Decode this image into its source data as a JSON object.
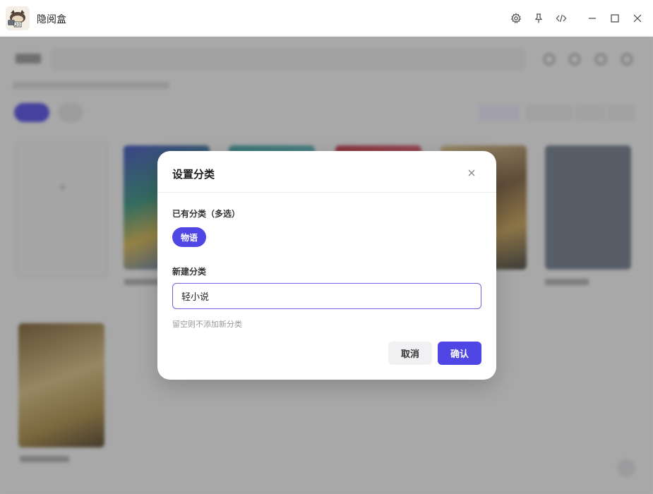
{
  "window": {
    "title": "隐阅盒",
    "icons": [
      "settings-icon",
      "pin-icon",
      "code-icon",
      "minimize-icon",
      "maximize-icon",
      "close-icon"
    ]
  },
  "dialog": {
    "title": "设置分类",
    "existing_label": "已有分类（多选）",
    "existing_tags": [
      "物语"
    ],
    "new_label": "新建分类",
    "new_value": "轻小说",
    "hint": "留空则不添加新分类",
    "cancel_label": "取消",
    "confirm_label": "确认"
  },
  "colors": {
    "accent": "#4f46e5",
    "overlay": "rgba(60,60,60,0.42)"
  }
}
